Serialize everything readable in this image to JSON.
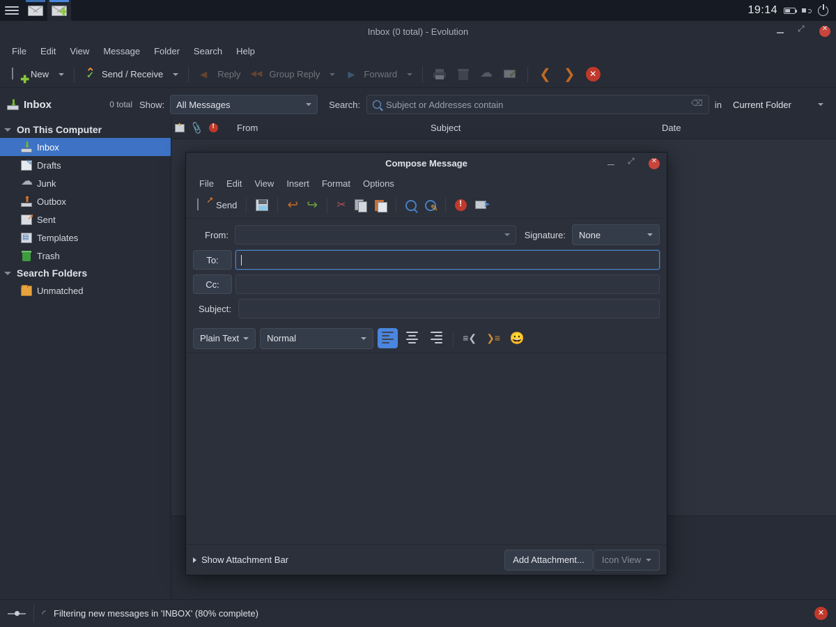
{
  "system_bar": {
    "apps": [
      {
        "name": "mail-app",
        "icon": "envelope-icon"
      },
      {
        "name": "compose-app",
        "icon": "envelope-plus-icon"
      }
    ],
    "clock": "19:14",
    "indicators": [
      "battery-icon",
      "volume-icon",
      "power-icon"
    ]
  },
  "window": {
    "title": "Inbox (0 total) - Evolution",
    "controls": {
      "minimize": "−",
      "maximize": "⤢",
      "close": "✕"
    }
  },
  "menubar": {
    "items": [
      "File",
      "Edit",
      "View",
      "Message",
      "Folder",
      "Search",
      "Help"
    ]
  },
  "toolbar": {
    "new_label": "New",
    "send_receive_label": "Send / Receive",
    "reply_label": "Reply",
    "group_reply_label": "Group Reply",
    "forward_label": "Forward",
    "icons": [
      "print-icon",
      "trash-icon",
      "junk-icon",
      "mark-read-icon",
      "back-icon",
      "forward-icon",
      "cancel-icon"
    ]
  },
  "searchbar": {
    "folder_name": "Inbox",
    "total_label": "0 total",
    "show_label": "Show:",
    "show_value": "All Messages",
    "search_label": "Search:",
    "search_value": "",
    "search_placeholder": "Subject or Addresses contain",
    "in_label": "in",
    "scope_value": "Current Folder"
  },
  "sidebar": {
    "groups": [
      {
        "label": "On This Computer",
        "items": [
          {
            "label": "Inbox",
            "icon": "inbox-icon",
            "selected": true
          },
          {
            "label": "Drafts",
            "icon": "drafts-icon",
            "selected": false
          },
          {
            "label": "Junk",
            "icon": "junk-icon",
            "selected": false
          },
          {
            "label": "Outbox",
            "icon": "outbox-icon",
            "selected": false
          },
          {
            "label": "Sent",
            "icon": "sent-icon",
            "selected": false
          },
          {
            "label": "Templates",
            "icon": "templates-icon",
            "selected": false
          },
          {
            "label": "Trash",
            "icon": "trash-icon",
            "selected": false
          }
        ]
      },
      {
        "label": "Search Folders",
        "items": [
          {
            "label": "Unmatched",
            "icon": "unmatched-folder-icon",
            "selected": false
          }
        ]
      }
    ]
  },
  "message_list": {
    "columns": [
      "From",
      "Subject",
      "Date"
    ],
    "icon_columns": [
      "read-status-icon",
      "attachment-icon",
      "importance-icon"
    ],
    "rows": []
  },
  "status_bar": {
    "text": "Filtering new messages in 'INBOX' (80% complete)",
    "progress": 80,
    "stop_icon": "cancel-icon"
  },
  "compose_dialog": {
    "title": "Compose Message",
    "menubar": [
      "File",
      "Edit",
      "View",
      "Insert",
      "Format",
      "Options"
    ],
    "toolbar": {
      "send_label": "Send",
      "icons": [
        "save-icon",
        "undo-icon",
        "redo-icon",
        "cut-icon",
        "copy-icon",
        "paste-icon",
        "find-icon",
        "replace-icon",
        "priority-icon",
        "send-later-icon"
      ]
    },
    "fields": {
      "from_label": "From:",
      "from_value": "",
      "signature_label": "Signature:",
      "signature_value": "None",
      "to_label": "To:",
      "to_value": "",
      "cc_label": "Cc:",
      "cc_value": "",
      "subject_label": "Subject:",
      "subject_value": ""
    },
    "format_toolbar": {
      "mode_value": "Plain Text",
      "style_value": "Normal",
      "align_left": "align-left",
      "align_center": "align-center",
      "align_right": "align-right",
      "outdent": "outdent",
      "indent": "indent",
      "emoji": "🙂"
    },
    "body_value": "",
    "footer": {
      "attachment_bar_label": "Show Attachment Bar",
      "add_attachment_label": "Add Attachment...",
      "view_mode_value": "Icon View"
    }
  },
  "colors": {
    "window_bg": "#272c36",
    "panel_bg": "#2b303b",
    "selection_blue": "#3d72c4",
    "accent_blue": "#4a86e0",
    "clock_orange": "#f2a93b",
    "danger_red": "#c0392b"
  }
}
